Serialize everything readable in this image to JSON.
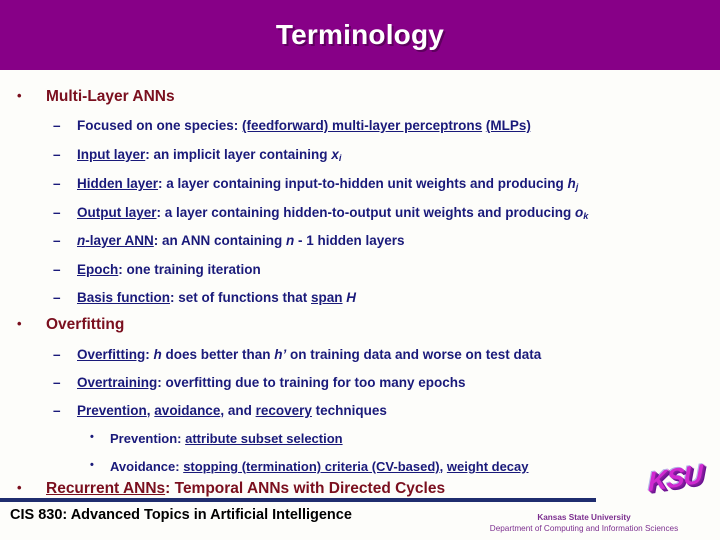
{
  "slide": {
    "title": "Terminology",
    "theme": {
      "banner_color": "#870087",
      "background_color": "#fdfdfa",
      "level1_color": "#7a0f1e",
      "level2_color": "#1a1a7a",
      "footer_rule_color": "#1f2d6e",
      "org_color": "#7c2f8f",
      "title_color": "#ffffff"
    }
  },
  "bullets": {
    "b1": {
      "marker": "•",
      "text": "Multi-Layer ANNs"
    },
    "b2": {
      "marker": "–",
      "text": "Focused on one species: (feedforward) multi-layer perceptrons (MLPs)"
    },
    "b3": {
      "marker": "–",
      "text": "Input layer: an implicit layer containing xi"
    },
    "b4": {
      "marker": "–",
      "text": "Hidden layer: a layer containing input-to-hidden unit weights and producing hj"
    },
    "b5": {
      "marker": "–",
      "text": "Output layer: a layer containing hidden-to-output unit weights and producing ok"
    },
    "b6": {
      "marker": "–",
      "text": "n-layer ANN: an ANN containing n - 1 hidden layers"
    },
    "b7": {
      "marker": "–",
      "text": "Epoch: one training iteration"
    },
    "b8": {
      "marker": "–",
      "text": "Basis function: set of functions that span H"
    },
    "b9": {
      "marker": "•",
      "text": "Overfitting"
    },
    "b10": {
      "marker": "–",
      "text": "Overfitting: h does better than h’ on training data and worse on test data"
    },
    "b11": {
      "marker": "–",
      "text": "Overtraining: overfitting due to training for too many epochs"
    },
    "b12": {
      "marker": "–",
      "text": "Prevention, avoidance, and recovery techniques"
    },
    "b13": {
      "marker": "•",
      "text": "Prevention: attribute subset selection"
    },
    "b14": {
      "marker": "•",
      "text": "Avoidance: stopping (termination) criteria (CV-based), weight decay"
    },
    "b15": {
      "marker": "•",
      "text": "Recurrent ANNs: Temporal ANNs with Directed Cycles"
    }
  },
  "footer": {
    "course": "CIS 830: Advanced Topics in Artificial Intelligence",
    "org_line1": "Kansas State University",
    "org_line2": "Department of Computing and Information Sciences",
    "logo_text": "KSU"
  }
}
